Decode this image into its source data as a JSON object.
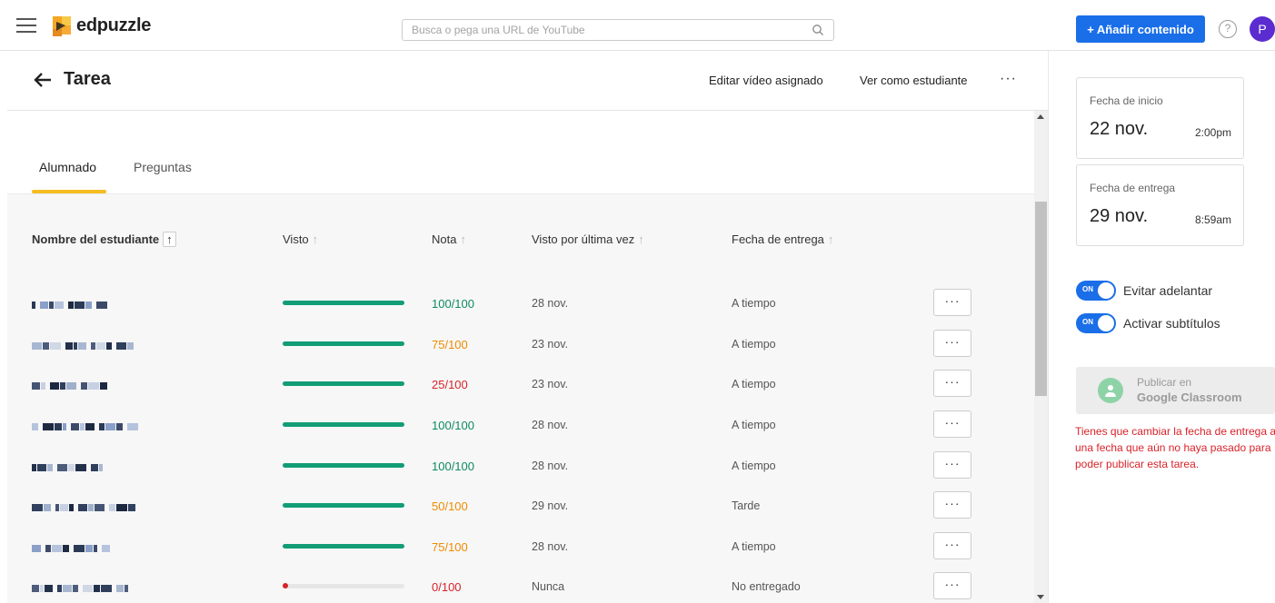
{
  "topbar": {
    "logo_text": "edpuzzle",
    "search_placeholder": "Busca o pega una URL de YouTube",
    "add_button": "+ Añadir contenido",
    "help": "?",
    "avatar_initial": "P",
    "brand_color": "#1a6ee8"
  },
  "header": {
    "title": "Tarea",
    "edit_link": "Editar vídeo asignado",
    "student_view_link": "Ver como estudiante",
    "more": "···"
  },
  "tabs": [
    {
      "label": "Alumnado",
      "active": true
    },
    {
      "label": "Preguntas",
      "active": false
    }
  ],
  "table": {
    "columns": [
      "Nombre del estudiante",
      "Visto",
      "Nota",
      "Visto por última vez",
      "Fecha de entrega"
    ],
    "sort_arrow": "↑",
    "more_label": "···",
    "rows": [
      {
        "name_blurred": true,
        "watched": 1.0,
        "grade": "100/100",
        "grade_level": "good",
        "last_seen": "28 nov.",
        "due_status": "A tiempo"
      },
      {
        "name_blurred": true,
        "watched": 1.0,
        "grade": "75/100",
        "grade_level": "mid",
        "last_seen": "23 nov.",
        "due_status": "A tiempo"
      },
      {
        "name_blurred": true,
        "watched": 1.0,
        "grade": "25/100",
        "grade_level": "bad",
        "last_seen": "23 nov.",
        "due_status": "A tiempo"
      },
      {
        "name_blurred": true,
        "watched": 1.0,
        "grade": "100/100",
        "grade_level": "good",
        "last_seen": "28 nov.",
        "due_status": "A tiempo"
      },
      {
        "name_blurred": true,
        "watched": 1.0,
        "grade": "100/100",
        "grade_level": "good",
        "last_seen": "28 nov.",
        "due_status": "A tiempo"
      },
      {
        "name_blurred": true,
        "watched": 1.0,
        "grade": "50/100",
        "grade_level": "mid",
        "last_seen": "29 nov.",
        "due_status": "Tarde"
      },
      {
        "name_blurred": true,
        "watched": 1.0,
        "grade": "75/100",
        "grade_level": "mid",
        "last_seen": "28 nov.",
        "due_status": "A tiempo"
      },
      {
        "name_blurred": true,
        "watched": 0.0,
        "grade": "0/100",
        "grade_level": "bad",
        "last_seen": "Nunca",
        "due_status": "No entregado"
      }
    ]
  },
  "sidebar": {
    "start": {
      "label": "Fecha de inicio",
      "date": "22 nov.",
      "time": "2:00pm"
    },
    "due": {
      "label": "Fecha de entrega",
      "date": "29 nov.",
      "time": "8:59am"
    },
    "toggles": [
      {
        "on_text": "ON",
        "label": "Evitar adelantar",
        "on": true
      },
      {
        "on_text": "ON",
        "label": "Activar subtítulos",
        "on": true
      }
    ],
    "classroom": {
      "line1": "Publicar en",
      "line2": "Google Classroom"
    },
    "warning": "Tienes que cambiar la fecha de entrega a una fecha que aún no haya pasado para poder publicar esta tarea."
  }
}
